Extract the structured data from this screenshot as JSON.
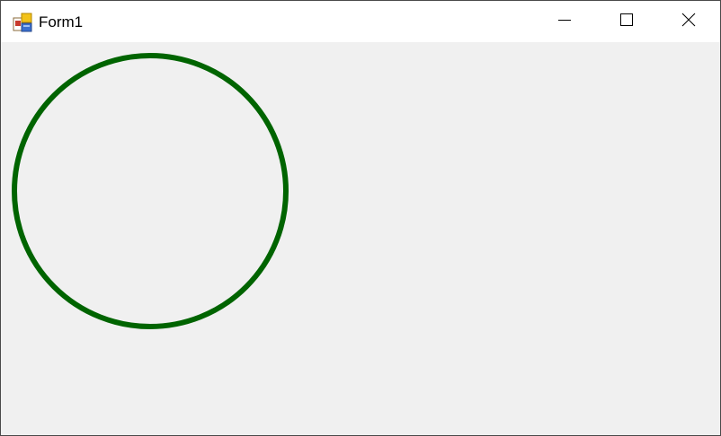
{
  "window": {
    "title": "Form1",
    "icon": "windows-forms-app-icon",
    "buttons": {
      "minimize": "minimize-icon",
      "maximize": "maximize-icon",
      "close": "close-icon"
    }
  },
  "canvas": {
    "shape": "circle",
    "stroke_color": "#006400",
    "fill": "none"
  }
}
